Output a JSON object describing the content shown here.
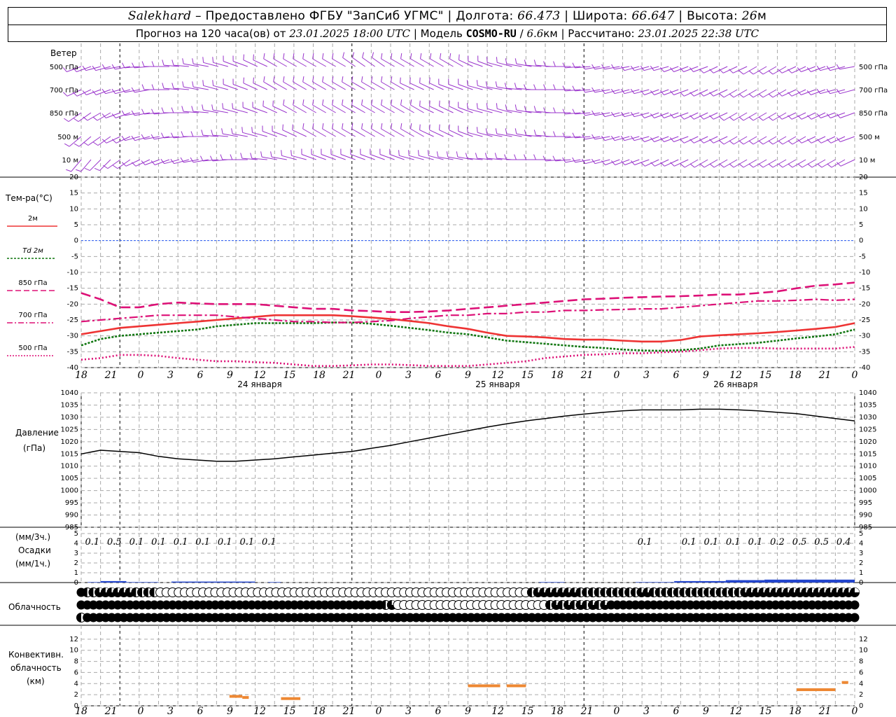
{
  "header": {
    "station": "Salekhard",
    "provider": "– Предоставлено ФГБУ \"ЗапСиб УГМС\"",
    "lon_label": "Долгота:",
    "lon_value": "66.473",
    "lat_label": "Широта:",
    "lat_value": "66.647",
    "alt_label": "Высота:",
    "alt_value": "26",
    "alt_unit": "м",
    "forecast_prefix": "Прогноз на 120 часа(ов) от",
    "forecast_start": "23.01.2025 18:00 UTC",
    "model_label": "Модель",
    "model_name": "COSMO-RU",
    "model_res": "6.6",
    "model_res_unit": "км",
    "calc_label": "Рассчитано:",
    "calc_time": "23.01.2025 22:38 UTC"
  },
  "labels": {
    "wind": "Ветер",
    "wind_levels": [
      "500 гПа",
      "700 гПа",
      "850 гПа",
      "500 м",
      "10 м"
    ],
    "temp_title": "Тем-ра(°C)",
    "legend": [
      {
        "name": "2м",
        "color": "#ee3333",
        "style": "solid"
      },
      {
        "name": "Td 2м",
        "color": "#117711",
        "style": "dotted"
      },
      {
        "name": "850 гПа",
        "color": "#dd1177",
        "style": "dashed"
      },
      {
        "name": "700 гПа",
        "color": "#dd1177",
        "style": "dashdot"
      },
      {
        "name": "500 гПа",
        "color": "#dd1177",
        "style": "dotted"
      }
    ],
    "pressure_title": "Давление",
    "pressure_unit": "(гПа)",
    "precip_unit_3h": "(мм/3ч.)",
    "precip_title": "Осадки",
    "precip_unit_1h": "(мм/1ч.)",
    "cloud_title": "Облачность",
    "conv_title_1": "Конвективн.",
    "conv_title_2": "облачность",
    "conv_unit": "(км)"
  },
  "axis": {
    "hour_ticks": [
      "18",
      "21",
      "0",
      "3",
      "6",
      "9",
      "12",
      "15",
      "18",
      "21",
      "0",
      "3",
      "6",
      "9",
      "12",
      "15",
      "18",
      "21",
      "0",
      "3",
      "6",
      "9",
      "12",
      "15",
      "18",
      "21",
      "0"
    ],
    "days": [
      "24 января",
      "25 января",
      "26 января"
    ]
  },
  "chart_data": [
    {
      "type": "line",
      "title": "Тем-ра(°C)",
      "x_hours": [
        0,
        3,
        6,
        9,
        12,
        15,
        18,
        21,
        24,
        27,
        30,
        33,
        36,
        39,
        42,
        45,
        48,
        51,
        54,
        57,
        60,
        63,
        66,
        69,
        72,
        75,
        78,
        81,
        84,
        87,
        90,
        93,
        96,
        99,
        102,
        105,
        108,
        111,
        114,
        117,
        120
      ],
      "ylim": [
        -40,
        20
      ],
      "yticks": [
        -40,
        -35,
        -30,
        -25,
        -20,
        -15,
        -10,
        -5,
        0,
        5,
        10,
        15,
        20
      ],
      "series": [
        {
          "name": "2м",
          "values": [
            -29.5,
            -28.5,
            -27.5,
            -27,
            -26.5,
            -26,
            -25.5,
            -25,
            -24.5,
            -24,
            -23.5,
            -23.5,
            -23.5,
            -23.5,
            -23.8,
            -24.2,
            -24.7,
            -25.3,
            -26,
            -27,
            -27.8,
            -29,
            -30,
            -30.2,
            -30.5,
            -31,
            -31.2,
            -31.2,
            -31.5,
            -31.8,
            -31.8,
            -31.3,
            -30.2,
            -29.8,
            -29.5,
            -29.2,
            -28.8,
            -28.3,
            -27.8,
            -27.2,
            -26
          ]
        },
        {
          "name": "Td 2м",
          "values": [
            -33,
            -31,
            -30,
            -29.5,
            -29,
            -28.5,
            -28,
            -27,
            -26.5,
            -26,
            -26,
            -26,
            -26,
            -25.8,
            -25.8,
            -26.2,
            -26.8,
            -27.5,
            -28.2,
            -29,
            -29.5,
            -30.5,
            -31.5,
            -32,
            -32.5,
            -33,
            -33.5,
            -33.8,
            -34.3,
            -34.6,
            -34.7,
            -34.5,
            -34,
            -33,
            -32.6,
            -32.2,
            -31.5,
            -30.8,
            -30.2,
            -29.5,
            -28
          ]
        },
        {
          "name": "850 гПа",
          "values": [
            -16.5,
            -18.5,
            -21,
            -21,
            -20,
            -19.5,
            -19.8,
            -20,
            -20,
            -20,
            -20.5,
            -21,
            -21.5,
            -21.5,
            -22,
            -22.2,
            -22.5,
            -22.5,
            -22.3,
            -22,
            -21.5,
            -21,
            -20.5,
            -20,
            -19.5,
            -19,
            -18.5,
            -18.3,
            -18,
            -17.8,
            -17.6,
            -17.5,
            -17.3,
            -17,
            -17,
            -16.5,
            -16,
            -15,
            -14.2,
            -13.8,
            -13.2
          ]
        },
        {
          "name": "700 гПа",
          "values": [
            -25.5,
            -25,
            -24.5,
            -24,
            -23.5,
            -23.5,
            -23.5,
            -23.5,
            -24,
            -24.5,
            -25,
            -25.5,
            -25.5,
            -25.8,
            -25.8,
            -25.5,
            -25.2,
            -24.5,
            -24,
            -23.5,
            -23.5,
            -23,
            -23,
            -22.5,
            -22.5,
            -22,
            -22,
            -21.8,
            -21.7,
            -21.5,
            -21.5,
            -21,
            -20.5,
            -20,
            -19.5,
            -19,
            -19,
            -18.8,
            -18.5,
            -18.8,
            -18.5
          ]
        },
        {
          "name": "500 гПа",
          "values": [
            -37.5,
            -37,
            -36,
            -36,
            -36.3,
            -37,
            -37.5,
            -38,
            -38,
            -38.3,
            -38.5,
            -39,
            -39.5,
            -39.5,
            -39.3,
            -39,
            -39,
            -39.2,
            -39.5,
            -39.5,
            -39.5,
            -39,
            -38.5,
            -38,
            -37,
            -36.5,
            -36,
            -35.8,
            -35.5,
            -35.5,
            -35.2,
            -35,
            -34.5,
            -34,
            -33.8,
            -33.8,
            -34,
            -34,
            -34,
            -34,
            -33.5
          ]
        }
      ]
    },
    {
      "type": "line",
      "title": "Давление",
      "ylabel": "(гПа)",
      "x_hours": [
        0,
        3,
        6,
        9,
        12,
        15,
        18,
        21,
        24,
        27,
        30,
        33,
        36,
        39,
        42,
        45,
        48,
        51,
        54,
        57,
        60,
        63,
        66,
        69,
        72,
        75,
        78,
        81,
        84,
        87,
        90,
        93,
        96,
        99,
        102,
        105,
        108,
        111,
        114,
        117,
        120
      ],
      "ylim": [
        985,
        1040
      ],
      "yticks": [
        985,
        990,
        995,
        1000,
        1005,
        1010,
        1015,
        1020,
        1025,
        1030,
        1035,
        1040
      ],
      "series": [
        {
          "name": "",
          "values": [
            1015,
            1016.5,
            1016,
            1015.5,
            1014,
            1013,
            1012.5,
            1012,
            1012,
            1012.5,
            1013,
            1013.8,
            1014.5,
            1015.3,
            1016,
            1017.3,
            1018.5,
            1020,
            1021.5,
            1023,
            1024.5,
            1026,
            1027.3,
            1028.5,
            1029.5,
            1030.5,
            1031.3,
            1032,
            1032.6,
            1033,
            1033,
            1033,
            1033.3,
            1033.3,
            1033,
            1032.6,
            1032,
            1031.5,
            1030.5,
            1029.5,
            1028.5
          ]
        }
      ]
    },
    {
      "type": "bar",
      "title": "Осадки",
      "ylim": [
        0,
        5
      ],
      "labels_3h": [
        {
          "hour": 1.5,
          "value": "0.1"
        },
        {
          "hour": 4.5,
          "value": "0.5"
        },
        {
          "hour": 7.5,
          "value": "0.1"
        },
        {
          "hour": 10.5,
          "value": "0.1"
        },
        {
          "hour": 13.5,
          "value": "0.1"
        },
        {
          "hour": 16.5,
          "value": "0.1"
        },
        {
          "hour": 19.5,
          "value": "0.1"
        },
        {
          "hour": 22.5,
          "value": "0.1"
        },
        {
          "hour": 25.5,
          "value": "0.1"
        },
        {
          "hour": 76.5,
          "value": "0.1"
        },
        {
          "hour": 82.5,
          "value": "0.1"
        },
        {
          "hour": 85.5,
          "value": "0.1"
        },
        {
          "hour": 88.5,
          "value": "0.1"
        },
        {
          "hour": 91.5,
          "value": "0.1"
        },
        {
          "hour": 94.5,
          "value": "0.2"
        },
        {
          "hour": 97.5,
          "value": "0.5"
        },
        {
          "hour": 100.5,
          "value": "0.5"
        },
        {
          "hour": 103.5,
          "value": "0.4"
        }
      ],
      "bars_1h": [
        {
          "start": 1,
          "end": 3,
          "value": 0.05
        },
        {
          "start": 3,
          "end": 7,
          "value": 0.15
        },
        {
          "start": 7,
          "end": 12,
          "value": 0.05
        },
        {
          "start": 14,
          "end": 27,
          "value": 0.1
        },
        {
          "start": 29,
          "end": 31,
          "value": 0.05
        },
        {
          "start": 71,
          "end": 75,
          "value": 0.05
        },
        {
          "start": 86,
          "end": 92,
          "value": 0.05
        },
        {
          "start": 92,
          "end": 100,
          "value": 0.15
        },
        {
          "start": 100,
          "end": 106,
          "value": 0.25
        },
        {
          "start": 106,
          "end": 120,
          "value": 0.3
        }
      ]
    },
    {
      "type": "bar",
      "title": "Конвективн. облачность",
      "ylabel": "(км)",
      "ylim": [
        0,
        14
      ],
      "yticks": [
        0,
        2,
        4,
        6,
        8,
        10,
        12
      ],
      "segments": [
        {
          "start": 23,
          "end": 25,
          "value": 1.7
        },
        {
          "start": 25,
          "end": 26,
          "value": 1.5
        },
        {
          "start": 31,
          "end": 34,
          "value": 1.3
        },
        {
          "start": 60,
          "end": 65,
          "value": 3.6
        },
        {
          "start": 66,
          "end": 69,
          "value": 3.6
        },
        {
          "start": 111,
          "end": 117,
          "value": 2.9
        },
        {
          "start": 118,
          "end": 119,
          "value": 4.2
        }
      ]
    }
  ],
  "cloud_rows": [
    {
      "layer": "upper",
      "values": "FHHQQQQQQHHHHEEEEEEEEEEEEEEEEEEEEEEEEEEEEEEEEEEEEEEEEEEEEEEEEEEEEEEEEEEEEEHQQQQQQQHHHHHHHHHHQQHHHHHHHHHHHHHHHQQQQQQQQQQQQQQQQQQQ"
    },
    {
      "layer": "middle",
      "values": "FFFFFFFFFFFFFFFFFFFFFFFFFFFFFFFFFFFFFFFFFFFFFFFFFFHQEEEEEEEEEEEEEEEEEEEEEEEEEHQHQHQHQHQFFFFFFFFFFFFFFFFFFFFFFFFFFFFFFFFFFFFFFFFF"
    },
    {
      "layer": "lower",
      "values": "HFFFFFFFFFFFFFFFFFFFFFFFFFFFFFFFFFFFFFFFFFFFFFFFFFFFFFFFFFFFFFFFFFFFFFFFFFFFFFFFFFFFFFFFFFFFFFFFFFFFFFFFFFFFFFFFFFFFFFFFFFFFFFFF"
    }
  ]
}
